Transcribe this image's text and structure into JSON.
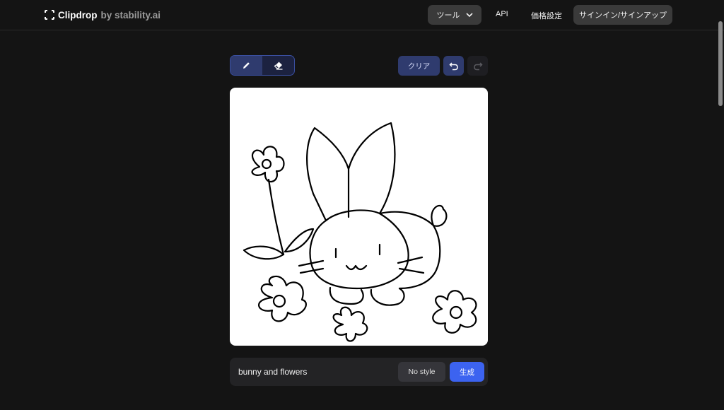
{
  "header": {
    "logo_name": "Clipdrop",
    "logo_by": "by stability.ai",
    "tools_label": "ツール",
    "api_label": "API",
    "pricing_label": "価格設定",
    "signin_label": "サインイン/サインアップ"
  },
  "toolbar": {
    "pencil_icon": "pencil-icon",
    "eraser_icon": "eraser-icon",
    "clear_label": "クリア",
    "undo_icon": "undo-icon",
    "redo_icon": "redo-icon"
  },
  "prompt": {
    "value": "bunny and flowers",
    "style_label": "No style",
    "generate_label": "生成"
  },
  "colors": {
    "background": "#141414",
    "accent": "#3c63f0",
    "tool_active": "#2f3b6e"
  }
}
